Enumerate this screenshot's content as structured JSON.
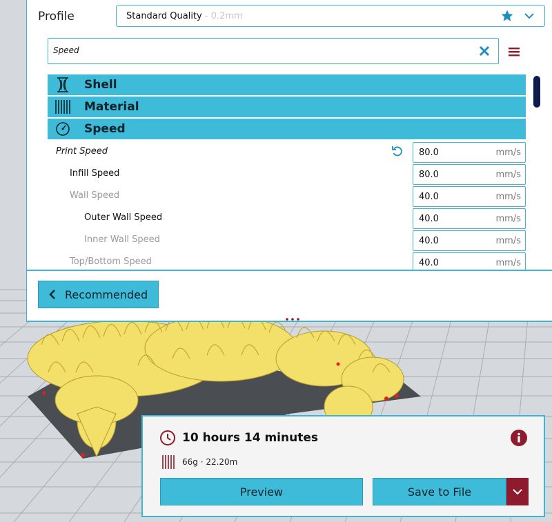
{
  "colors": {
    "accent": "#3ebbd8",
    "dark_red": "#8e1a2e",
    "scroll_thumb": "#0f1b4a"
  },
  "profile": {
    "label": "Profile",
    "quality": "Standard Quality",
    "layer_height": " - 0.2mm"
  },
  "search": {
    "value": "Speed"
  },
  "categories": [
    {
      "label": "Shell",
      "icon": "shell-icon"
    },
    {
      "label": "Material",
      "icon": "material-icon"
    },
    {
      "label": "Speed",
      "icon": "speed-gauge-icon"
    }
  ],
  "settings": [
    {
      "name": "Print Speed",
      "value": "80.0",
      "unit": "mm/s"
    },
    {
      "name": "Infill Speed",
      "value": "80.0",
      "unit": "mm/s"
    },
    {
      "name": "Wall Speed",
      "value": "40.0",
      "unit": "mm/s"
    },
    {
      "name": "Outer Wall Speed",
      "value": "40.0",
      "unit": "mm/s"
    },
    {
      "name": "Inner Wall Speed",
      "value": "40.0",
      "unit": "mm/s"
    },
    {
      "name": "Top/Bottom Speed",
      "value": "40.0",
      "unit": "mm/s"
    }
  ],
  "mode_button": {
    "label": "Recommended"
  },
  "print_info": {
    "time": "10 hours 14 minutes",
    "filament": "66g · 22.20m",
    "preview_label": "Preview",
    "save_label": "Save to File"
  }
}
